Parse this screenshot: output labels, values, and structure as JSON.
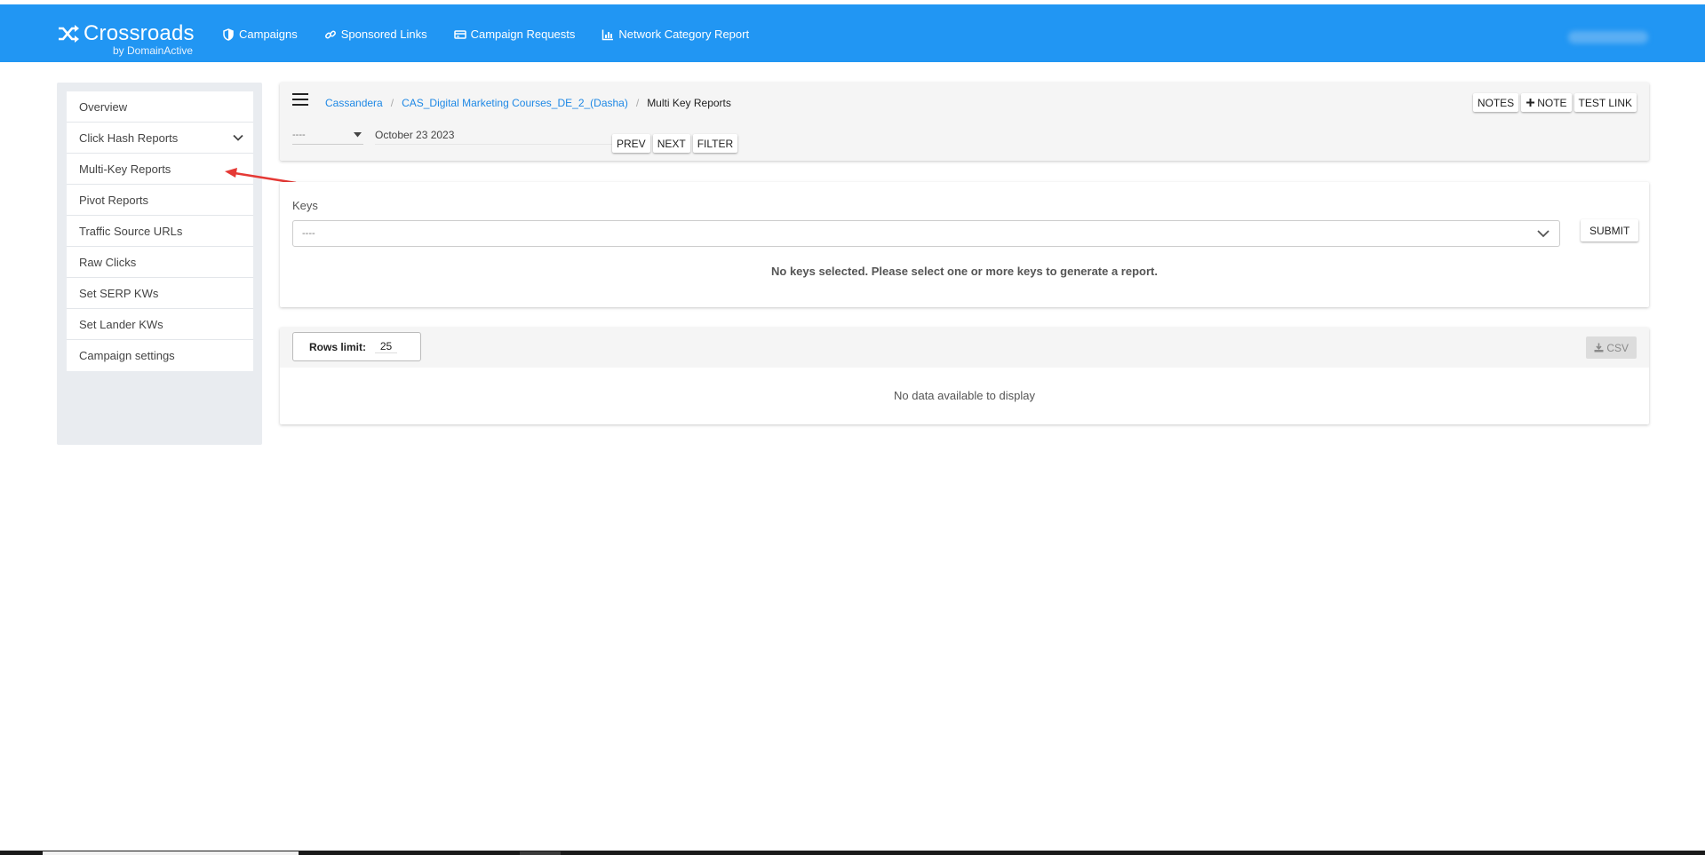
{
  "brand": {
    "name": "Crossroads",
    "sub": "by DomainActive"
  },
  "nav": [
    {
      "label": "Campaigns",
      "icon": "shield-icon"
    },
    {
      "label": "Sponsored Links",
      "icon": "link-icon"
    },
    {
      "label": "Campaign Requests",
      "icon": "card-icon"
    },
    {
      "label": "Network Category Report",
      "icon": "chart-icon"
    }
  ],
  "sidebar": {
    "items": [
      {
        "label": "Overview"
      },
      {
        "label": "Click Hash Reports"
      },
      {
        "label": "Multi-Key Reports"
      },
      {
        "label": "Pivot Reports"
      },
      {
        "label": "Traffic Source URLs"
      },
      {
        "label": "Raw Clicks"
      },
      {
        "label": "Set SERP KWs"
      },
      {
        "label": "Set Lander KWs"
      },
      {
        "label": "Campaign settings"
      }
    ]
  },
  "breadcrumb": {
    "items": [
      "Cassandera",
      "CAS_Digital Marketing Courses_DE_2_(Dasha)"
    ],
    "current": "Multi Key Reports"
  },
  "header_buttons": {
    "notes": "NOTES",
    "note": "NOTE",
    "test_link": "TEST LINK"
  },
  "filters": {
    "select_value": "----",
    "date": "October 23 2023",
    "prev": "PREV",
    "next": "NEXT",
    "filter": "FILTER"
  },
  "keys": {
    "label": "Keys",
    "select_value": "----",
    "submit": "SUBMIT",
    "message": "No keys selected. Please select one or more keys to generate a report."
  },
  "data_table": {
    "rows_limit_label": "Rows limit:",
    "rows_limit_value": "25",
    "csv": "CSV",
    "empty_message": "No data available to display"
  },
  "colors": {
    "topbar": "#2196f3",
    "link": "#1e88e5",
    "annotation_arrow": "#e53935"
  }
}
